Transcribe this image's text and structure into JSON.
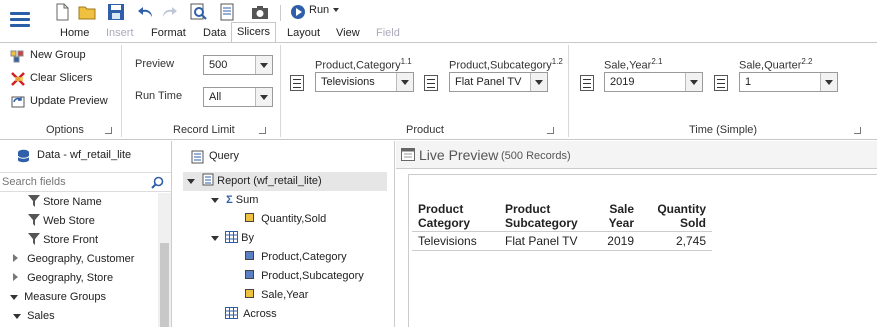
{
  "toolbar": {
    "run_label": "Run",
    "tabs": [
      {
        "label": "Home",
        "state": "normal"
      },
      {
        "label": "Insert",
        "state": "disabled"
      },
      {
        "label": "Format",
        "state": "normal"
      },
      {
        "label": "Data",
        "state": "normal"
      },
      {
        "label": "Slicers",
        "state": "active"
      },
      {
        "label": "Layout",
        "state": "normal"
      },
      {
        "label": "View",
        "state": "normal"
      },
      {
        "label": "Field",
        "state": "disabled"
      }
    ]
  },
  "ribbon": {
    "options": {
      "title": "Options",
      "new_group": "New Group",
      "clear_slicers": "Clear Slicers",
      "update_preview": "Update Preview"
    },
    "record_limit": {
      "title": "Record Limit",
      "preview_label": "Preview",
      "preview_value": "500",
      "run_time_label": "Run Time",
      "run_time_value": "All"
    },
    "product": {
      "title": "Product",
      "category_label": "Product,Category",
      "category_sup": "1.1",
      "category_value": "Televisions",
      "subcategory_label": "Product,Subcategory",
      "subcategory_sup": "1.2",
      "subcategory_value": "Flat Panel TV"
    },
    "time": {
      "title": "Time (Simple)",
      "year_label": "Sale,Year",
      "year_sup": "2.1",
      "year_value": "2019",
      "quarter_label": "Sale,Quarter",
      "quarter_sup": "2.2",
      "quarter_value": "1"
    }
  },
  "data_panel": {
    "title": "Data - wf_retail_lite",
    "search_placeholder": "Search fields",
    "items": [
      {
        "label": "Store Name"
      },
      {
        "label": "Web Store"
      },
      {
        "label": "Store Front"
      },
      {
        "label": "Geography, Customer"
      },
      {
        "label": "Geography, Store"
      },
      {
        "label": "Measure Groups"
      },
      {
        "label": "Sales"
      }
    ]
  },
  "query_panel": {
    "title": "Query",
    "report": "Report (wf_retail_lite)",
    "sum": "Sum",
    "quantity_sold": "Quantity,Sold",
    "by": "By",
    "product_category": "Product,Category",
    "product_subcategory": "Product,Subcategory",
    "sale_year": "Sale,Year",
    "across": "Across"
  },
  "preview": {
    "title": "Live Preview",
    "records": "(500 Records)",
    "columns": [
      {
        "l1": "Product",
        "l2": "Category"
      },
      {
        "l1": "Product",
        "l2": "Subcategory"
      },
      {
        "l1": "Sale",
        "l2": "Year"
      },
      {
        "l1": "Quantity",
        "l2": "Sold"
      }
    ],
    "row": [
      "Televisions",
      "Flat Panel TV",
      "2019",
      "2,745"
    ]
  }
}
